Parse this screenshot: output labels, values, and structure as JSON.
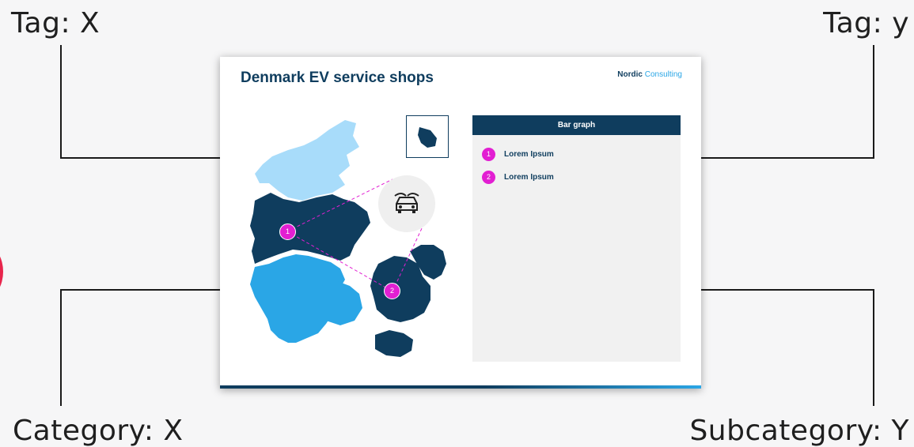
{
  "tags": {
    "top_left": "Tag:  X",
    "top_right": "Tag: y",
    "bottom_left": "Category: X",
    "bottom_right": "Subcategory: Y"
  },
  "slide": {
    "title": "Denmark EV service shops",
    "brand_part1": "Nordic",
    "brand_part2": " Consulting",
    "panel_title": "Bar graph",
    "legend": [
      {
        "number": "1",
        "label": "Lorem Ipsum"
      },
      {
        "number": "2",
        "label": "Lorem Ipsum"
      }
    ],
    "markers": [
      "1",
      "2"
    ]
  },
  "colors": {
    "navy": "#0f3d5e",
    "light_blue": "#a8dcfa",
    "mid_blue": "#2aa6e6",
    "marker": "#e21fd2",
    "accent_red": "#e8254c"
  },
  "icons": [
    "car-icon",
    "island-map-icon"
  ]
}
